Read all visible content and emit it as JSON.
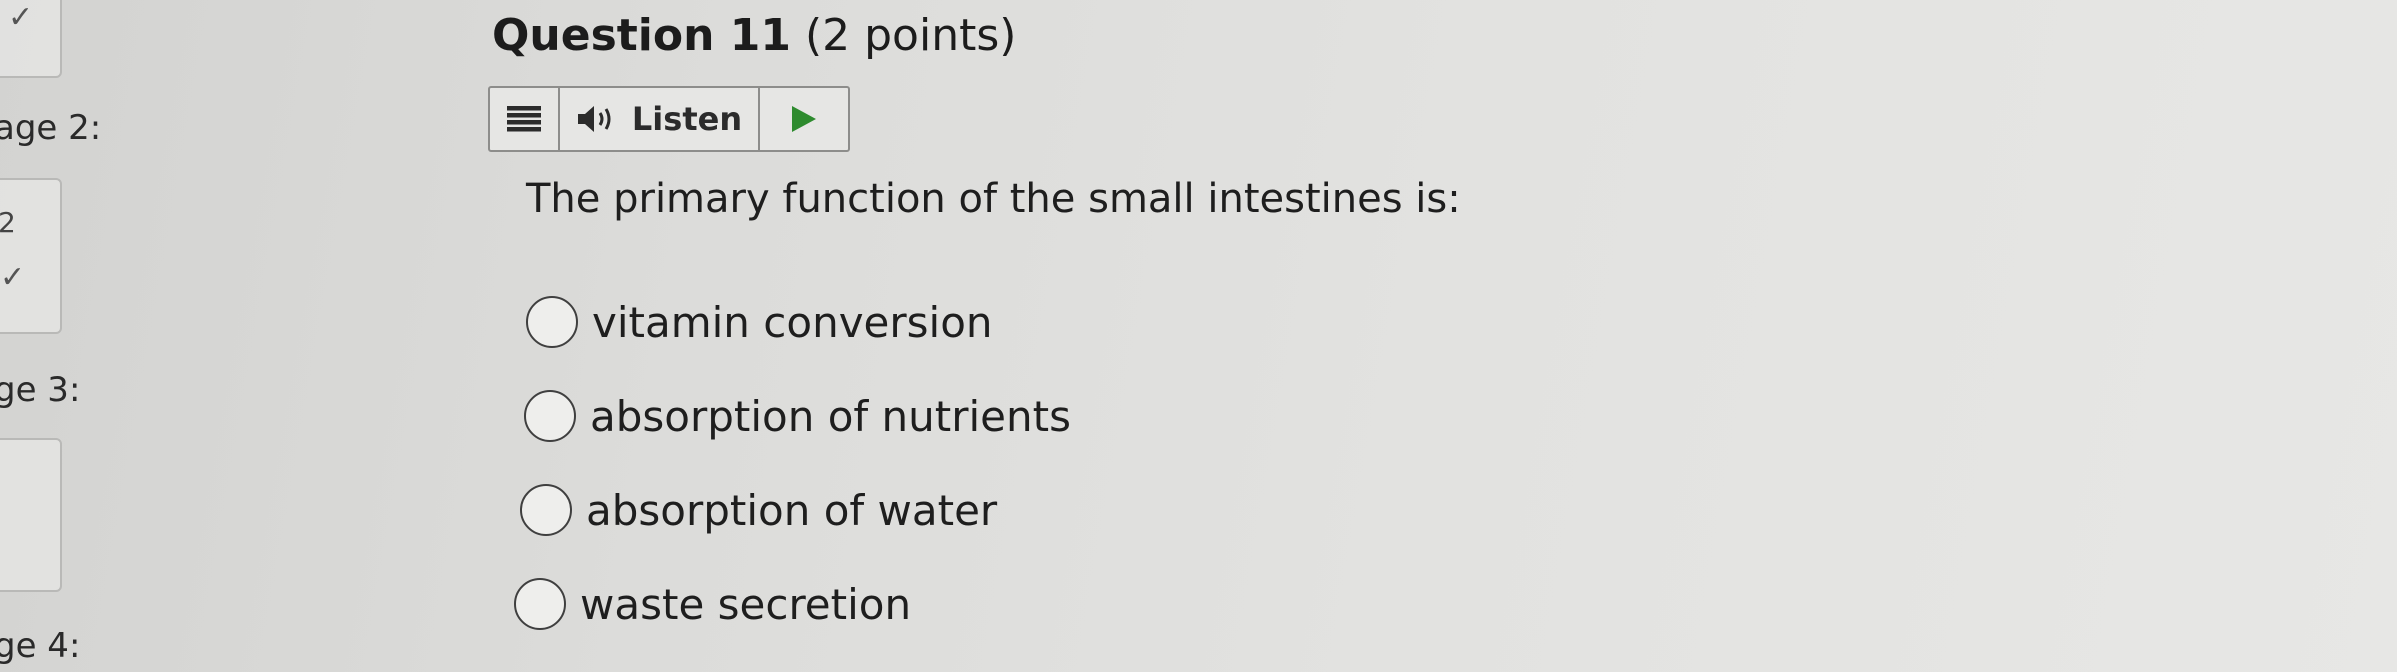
{
  "sidebar": {
    "pages": [
      {
        "label": "age 2:"
      },
      {
        "label": "ge 3:"
      },
      {
        "label": "ge 4:"
      }
    ],
    "box_number": "2"
  },
  "question": {
    "number_label": "Question 11",
    "points_label": "(2 points)",
    "prompt": "The primary function of the small intestines is:",
    "options": [
      {
        "label": "vitamin conversion",
        "selected": false
      },
      {
        "label": "absorption of nutrients",
        "selected": false
      },
      {
        "label": "absorption of water",
        "selected": false
      },
      {
        "label": "waste secretion",
        "selected": false
      }
    ]
  },
  "listen_bar": {
    "menu_icon": "hamburger-icon",
    "speaker_icon": "speaker-icon",
    "listen_label": "Listen",
    "play_icon": "play-icon",
    "play_color": "#2e8b2e"
  }
}
